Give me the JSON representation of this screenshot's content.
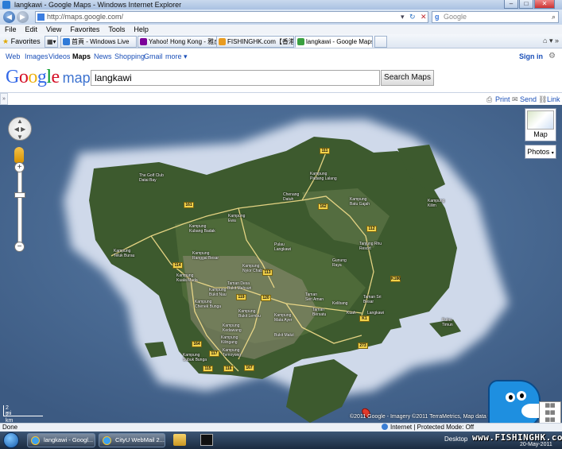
{
  "window": {
    "title": "langkawi - Google Maps - Windows Internet Explorer"
  },
  "address": {
    "url": "http://maps.google.com/",
    "search_placeholder": "Google"
  },
  "menu": [
    "File",
    "Edit",
    "View",
    "Favorites",
    "Tools",
    "Help"
  ],
  "favorites": {
    "label": "Favorites",
    "tabs": [
      {
        "label": "首頁 - Windows Live",
        "color": "#2f7ad8"
      },
      {
        "label": "Yahoo! Hong Kong - 雅虎...",
        "color": "#7b0099"
      },
      {
        "label": "FISHINGHK.com【香港魚...",
        "color": "#e89b20"
      },
      {
        "label": "langkawi - Google Maps",
        "color": "#3aa040"
      }
    ]
  },
  "gbar": {
    "links": [
      "Web",
      "Images",
      "Videos",
      "Maps",
      "News",
      "Shopping",
      "Gmail",
      "more ▾"
    ],
    "signin": "Sign in"
  },
  "header": {
    "logo_google": "Google",
    "logo_maps": "maps",
    "query": "langkawi",
    "search_button": "Search Maps"
  },
  "linkrow": {
    "print": "Print",
    "send": "Send",
    "link": "Link"
  },
  "map": {
    "type_button": "Map",
    "photos_button": "Photos",
    "scale_mi": "2 mi",
    "scale_km": "2 km",
    "copyright": "©2011 Google - Imagery ©2011 TerraMetrics, Map data ©2011 Mapabc.com",
    "place_labels": [
      "The Golf Club\nDatai Bay",
      "Kampung\nPadang Lalang",
      "Chenang\nDatuh",
      "Kampung\nBatu Gajah",
      "Kampung\nKilim",
      "Tanjung Rhu\nResort",
      "Kampung\nEwa",
      "Kampung\nKubang Badak",
      "Kampung\nTeluk Burau",
      "Kampung\nRanggal Besar",
      "Pulau\nLangkawi",
      "Gunung\nRaya",
      "Kampung\nKuala Muda",
      "Kampung\nNyior Chabang",
      "Taman Desa\nBukit Mahsuri",
      "Kampung\nBukit Nau",
      "Kampung\nChenek Bunga",
      "Kampung\nBukit Lembu",
      "Taman\nSeri Aman",
      "Taman\nBersatu",
      "Kampung\nMata Ayer",
      "Kelibang",
      "Kuah",
      "Langkawi",
      "Taman Sri\nBesar",
      "Kampung\nKedawang",
      "Kampung\nKilingang",
      "Kampung\nTemoyong",
      "Kampung\nSubuk Bunga",
      "Bukit Malut",
      "Pulau\nTimun"
    ],
    "route_shields": [
      "111",
      "161",
      "162",
      "112",
      "114",
      "113",
      "115",
      "116",
      "119",
      "120",
      "117",
      "167",
      "164",
      "273",
      "K186",
      "K1"
    ]
  },
  "status": {
    "left": "Done",
    "zone": "Internet | Protected Mode: Off"
  },
  "taskbar": {
    "buttons": [
      "langkawi - Googl...",
      "CityU WebMail 2..."
    ],
    "desktop": "Desktop",
    "watermark": "www.FISHINGHK.com",
    "date": "20-May-2011"
  },
  "colors": {
    "sea": "#4a6b93",
    "reef": "#c9d3e6",
    "land": "#3d5a2e",
    "road": "#f5e08c"
  }
}
